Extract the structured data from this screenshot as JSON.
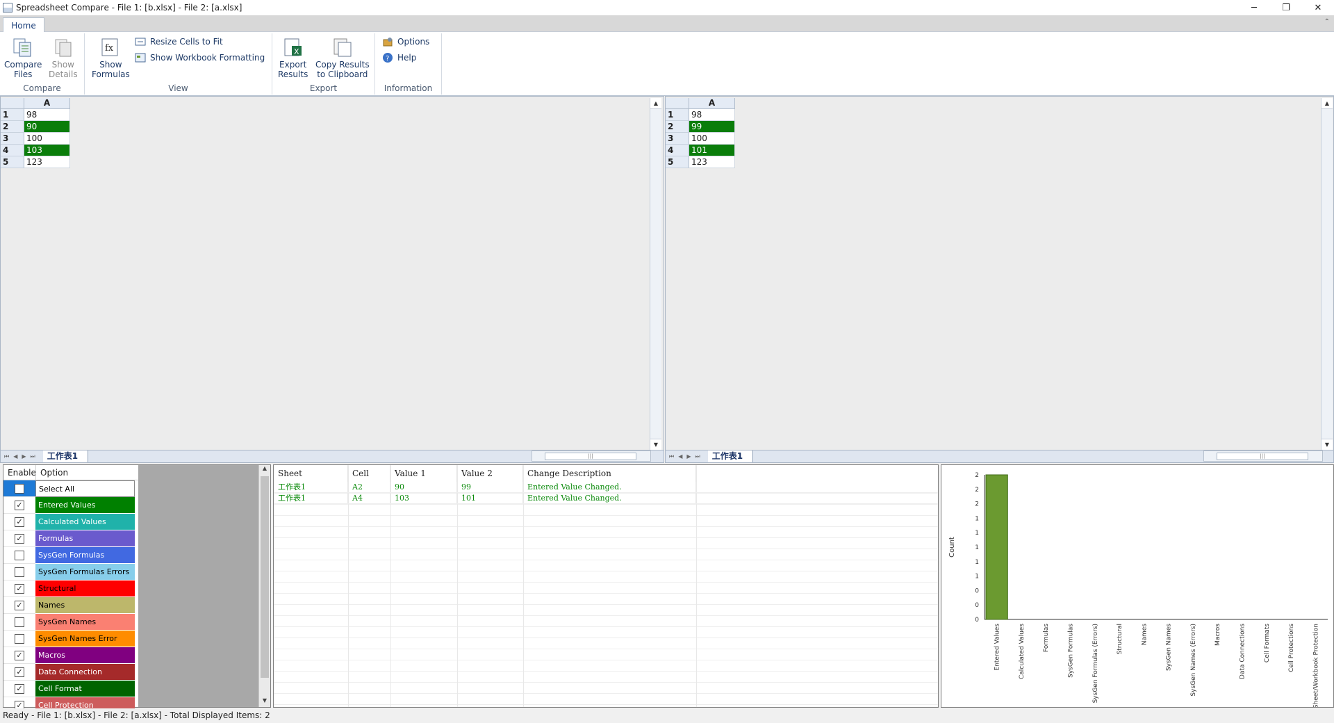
{
  "window": {
    "title": "Spreadsheet Compare - File 1: [b.xlsx] - File 2: [a.xlsx]",
    "minimize": "─",
    "maximize": "❐",
    "close": "✕"
  },
  "ribbon": {
    "tab": "Home",
    "collapse": "⌃",
    "groups": {
      "compare": {
        "label": "Compare",
        "compare_files": [
          "Compare",
          "Files"
        ],
        "show_details": [
          "Show",
          "Details"
        ]
      },
      "view": {
        "label": "View",
        "show_formulas": [
          "Show",
          "Formulas"
        ],
        "resize_cells": "Resize Cells to Fit",
        "show_workbook_formatting": "Show Workbook Formatting"
      },
      "export": {
        "label": "Export",
        "export_results": [
          "Export",
          "Results"
        ],
        "copy_results": [
          "Copy Results",
          "to Clipboard"
        ]
      },
      "information": {
        "label": "Information",
        "options": "Options",
        "help": "Help"
      }
    }
  },
  "left_pane": {
    "column": "A",
    "rows": [
      {
        "num": "1",
        "value": "98",
        "diff": false
      },
      {
        "num": "2",
        "value": "90",
        "diff": true
      },
      {
        "num": "3",
        "value": "100",
        "diff": false
      },
      {
        "num": "4",
        "value": "103",
        "diff": true
      },
      {
        "num": "5",
        "value": "123",
        "diff": false
      }
    ],
    "sheet_tab": "工作表1"
  },
  "right_pane": {
    "column": "A",
    "rows": [
      {
        "num": "1",
        "value": "98",
        "diff": false
      },
      {
        "num": "2",
        "value": "99",
        "diff": true
      },
      {
        "num": "3",
        "value": "100",
        "diff": false
      },
      {
        "num": "4",
        "value": "101",
        "diff": true
      },
      {
        "num": "5",
        "value": "123",
        "diff": false
      }
    ],
    "sheet_tab": "工作表1"
  },
  "options": {
    "headers": {
      "enable": "Enable",
      "option": "Option"
    },
    "items": [
      {
        "label": "Select All",
        "checked": false,
        "color": "#ffffff",
        "text_color": "#000000"
      },
      {
        "label": "Entered Values",
        "checked": true,
        "color": "#008000",
        "text_color": "#ffffff"
      },
      {
        "label": "Calculated Values",
        "checked": true,
        "color": "#20b2aa",
        "text_color": "#ffffff"
      },
      {
        "label": "Formulas",
        "checked": true,
        "color": "#6a5acd",
        "text_color": "#ffffff"
      },
      {
        "label": "SysGen Formulas",
        "checked": false,
        "color": "#4169e1",
        "text_color": "#ffffff"
      },
      {
        "label": "SysGen Formulas Errors",
        "checked": false,
        "color": "#87ceeb",
        "text_color": "#000000"
      },
      {
        "label": "Structural",
        "checked": true,
        "color": "#ff0000",
        "text_color": "#000000"
      },
      {
        "label": "Names",
        "checked": true,
        "color": "#bdb76b",
        "text_color": "#000000"
      },
      {
        "label": "SysGen Names",
        "checked": false,
        "color": "#fa8072",
        "text_color": "#000000"
      },
      {
        "label": "SysGen Names Error",
        "checked": false,
        "color": "#ff8c00",
        "text_color": "#000000"
      },
      {
        "label": "Macros",
        "checked": true,
        "color": "#800080",
        "text_color": "#ffffff"
      },
      {
        "label": "Data Connection",
        "checked": true,
        "color": "#a52a2a",
        "text_color": "#ffffff"
      },
      {
        "label": "Cell Format",
        "checked": true,
        "color": "#006400",
        "text_color": "#ffffff"
      },
      {
        "label": "Cell Protection",
        "checked": true,
        "color": "#cd5c5c",
        "text_color": "#ffffff"
      }
    ]
  },
  "results": {
    "headers": [
      "Sheet",
      "Cell",
      "Value 1",
      "Value 2",
      "Change Description"
    ],
    "rows": [
      [
        "工作表1",
        "A2",
        "90",
        "99",
        "Entered Value Changed."
      ],
      [
        "工作表1",
        "A4",
        "103",
        "101",
        "Entered Value Changed."
      ]
    ]
  },
  "chart_data": {
    "type": "bar",
    "ylabel": "Count",
    "y_ticks": [
      "0",
      "0",
      "0",
      "1",
      "1",
      "1",
      "1",
      "1",
      "2",
      "2",
      "2"
    ],
    "categories": [
      "Entered Values",
      "Calculated Values",
      "Formulas",
      "SysGen Formulas",
      "SysGen Formulas (Errors)",
      "Structural",
      "Names",
      "SysGen Names",
      "SysGen Names (Errors)",
      "Macros",
      "Data Connections",
      "Cell Formats",
      "Cell Protections",
      "Sheet/Workbook Protection"
    ],
    "values": [
      2,
      0,
      0,
      0,
      0,
      0,
      0,
      0,
      0,
      0,
      0,
      0,
      0,
      0
    ],
    "ylim": [
      0,
      2
    ],
    "bar_color": "#6b9a30"
  },
  "status": "Ready - File 1: [b.xlsx] - File 2: [a.xlsx] - Total Displayed Items: 2"
}
